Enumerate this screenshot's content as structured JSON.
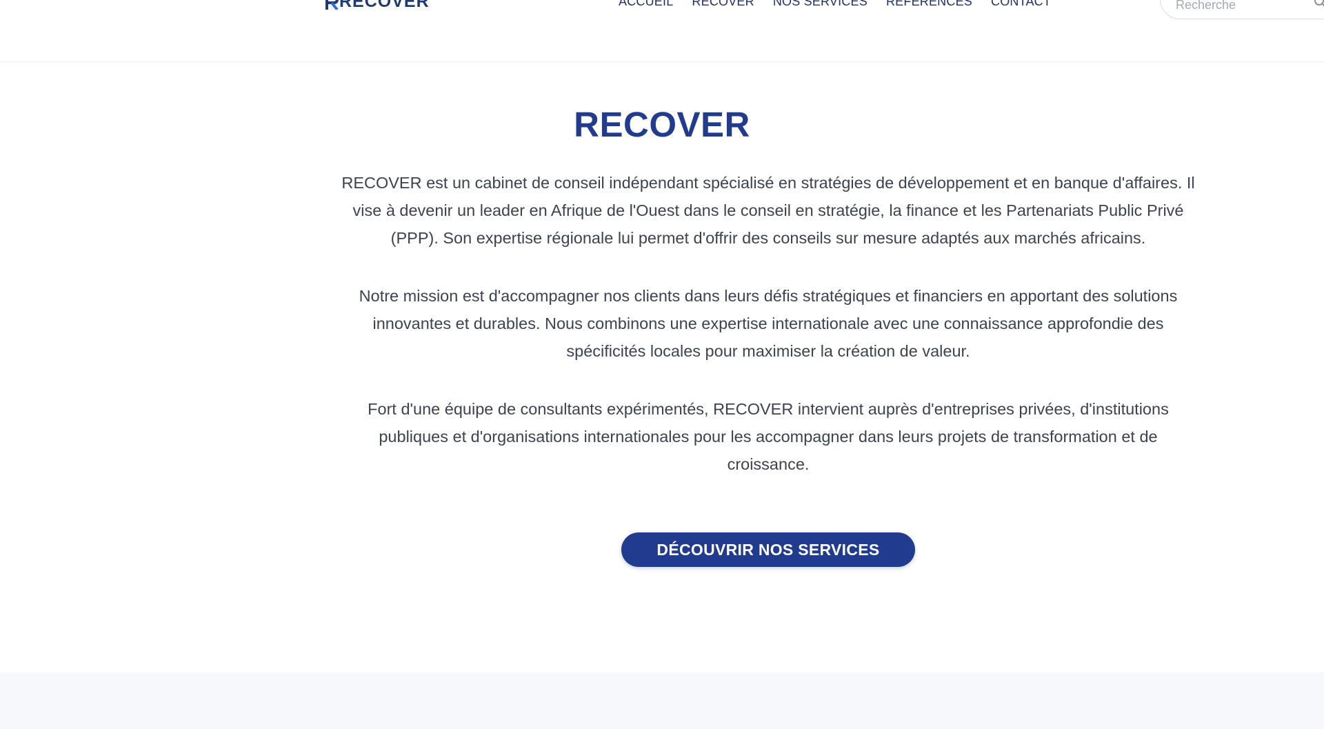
{
  "header": {
    "logo_text": "RECOVER",
    "nav": [
      {
        "label": "ACCUEIL"
      },
      {
        "label": "RECOVER"
      },
      {
        "label": "NOS SERVICES"
      },
      {
        "label": "REFERENCES"
      },
      {
        "label": "CONTACT"
      }
    ],
    "search": {
      "placeholder": "Recherche",
      "value": ""
    }
  },
  "main": {
    "title": "RECOVER",
    "paragraphs": [
      "RECOVER est un cabinet de conseil indépendant spécialisé en stratégies de développement et en banque d'affaires. Il vise à devenir un leader en Afrique de l'Ouest dans le conseil en stratégie, la finance et les Partenariats Public Privé (PPP). Son expertise régionale lui permet d'offrir des conseils sur mesure adaptés aux marchés africains.",
      "Notre mission est d'accompagner nos clients dans leurs défis stratégiques et financiers en apportant des solutions innovantes et durables. Nous combinons une expertise internationale avec une connaissance approfondie des spécificités locales pour maximiser la création de valeur.",
      "Fort d'une équipe de consultants expérimentés, RECOVER intervient auprès d'entreprises privées, d'institutions publiques et d'organisations internationales pour les accompagner dans leurs projets de transformation et de croissance."
    ],
    "cta_label": "DÉCOUVRIR NOS SERVICES"
  },
  "colors": {
    "brand": "#213b8f",
    "nav_text": "#22306e",
    "body_text": "#3c4250",
    "footer_bg": "#f6f8fb"
  },
  "icons": {
    "logo": "recover-logo-icon",
    "search": "search-icon"
  }
}
